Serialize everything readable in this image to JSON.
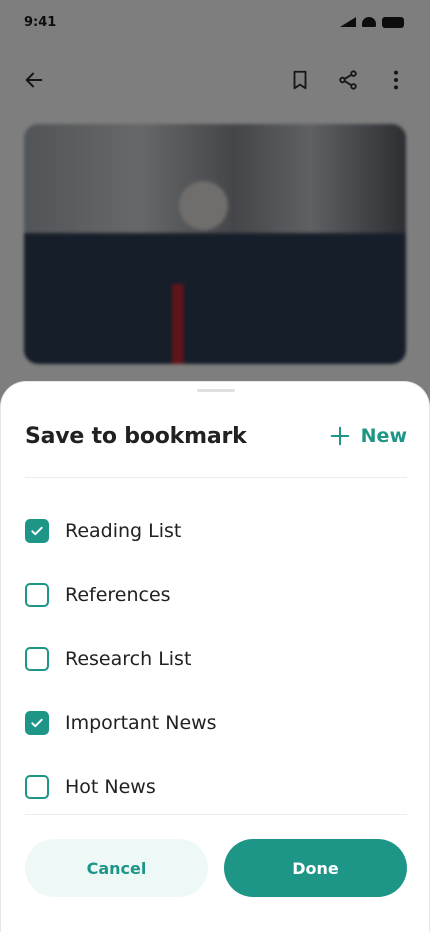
{
  "status_bar": {
    "time": "9:41"
  },
  "sheet": {
    "title": "Save to bookmark",
    "new_label": "New",
    "items": [
      {
        "label": "Reading List",
        "checked": true
      },
      {
        "label": "References",
        "checked": false
      },
      {
        "label": "Research List",
        "checked": false
      },
      {
        "label": "Important News",
        "checked": true
      },
      {
        "label": "Hot News",
        "checked": false
      }
    ],
    "cancel_label": "Cancel",
    "done_label": "Done"
  },
  "icons": {
    "back": "arrow-left-icon",
    "bookmark": "bookmark-icon",
    "share": "share-icon",
    "more": "more-vertical-icon",
    "add": "plus-icon",
    "check": "check-icon"
  },
  "colors": {
    "accent": "#1d9688",
    "accent_light": "#eef8f7",
    "text": "#212121",
    "scrim": "rgba(10,10,10,0.5)"
  }
}
